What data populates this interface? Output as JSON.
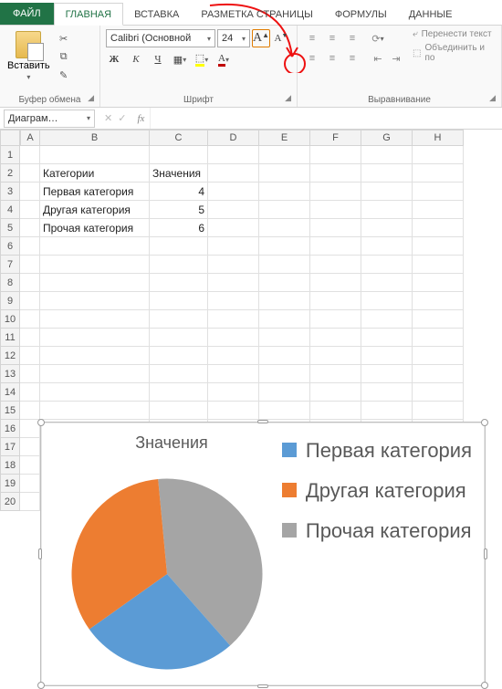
{
  "tabs": {
    "file": "ФАЙЛ",
    "home": "ГЛАВНАЯ",
    "insert": "ВСТАВКА",
    "pagelayout": "РАЗМЕТКА СТРАНИЦЫ",
    "formulas": "ФОРМУЛЫ",
    "data": "ДАННЫЕ"
  },
  "ribbon": {
    "clipboard": {
      "paste": "Вставить",
      "label": "Буфер обмена"
    },
    "font": {
      "name": "Calibri (Основной",
      "size": "24",
      "bold": "Ж",
      "italic": "К",
      "underline": "Ч",
      "label": "Шрифт"
    },
    "alignment": {
      "wrap": "Перенести текст",
      "merge": "Объединить и по",
      "label": "Выравнивание"
    }
  },
  "namebox": "Диаграм…",
  "columns": [
    "A",
    "B",
    "C",
    "D",
    "E",
    "F",
    "G",
    "H"
  ],
  "table": {
    "hB": "Категории",
    "hC": "Значения",
    "r1B": "Первая категория",
    "r1C": "4",
    "r2B": "Другая категория",
    "r2C": "5",
    "r3B": "Прочая категория",
    "r3C": "6"
  },
  "chart": {
    "title": "Значения",
    "legend1": "Первая категория",
    "legend2": "Другая категория",
    "legend3": "Прочая категория"
  },
  "chart_data": {
    "type": "pie",
    "title": "Значения",
    "series": [
      {
        "name": "Первая категория",
        "value": 4,
        "color": "#5b9bd5"
      },
      {
        "name": "Другая категория",
        "value": 5,
        "color": "#ed7d31"
      },
      {
        "name": "Прочая категория",
        "value": 6,
        "color": "#a5a5a5"
      }
    ]
  }
}
